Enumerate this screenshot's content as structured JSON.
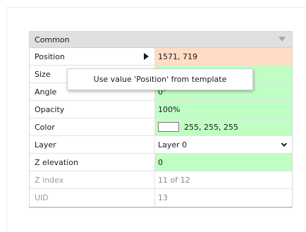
{
  "panel": {
    "group_label": "Common",
    "properties": [
      {
        "name": "Position",
        "value": "1571, 719"
      },
      {
        "name": "Size",
        "value": ""
      },
      {
        "name": "Angle",
        "value": "0°"
      },
      {
        "name": "Opacity",
        "value": "100%"
      },
      {
        "name": "Color",
        "value": "255, 255, 255"
      },
      {
        "name": "Layer",
        "value": "Layer 0"
      },
      {
        "name": "Z elevation",
        "value": "0"
      },
      {
        "name": "Z index",
        "value": "11 of 12"
      },
      {
        "name": "UID",
        "value": "13"
      }
    ]
  },
  "tooltip": {
    "text": "Use value 'Position' from template"
  },
  "colors": {
    "overridden_bg": "#ffdcc4",
    "template_bg": "#c0ffc4",
    "header_bg": "#e0e0e0",
    "color_swatch": "#ffffff"
  },
  "icons": {
    "expand": "triangle-right-icon",
    "collapse": "triangle-down-icon",
    "dropdown": "chevron-down-icon"
  }
}
